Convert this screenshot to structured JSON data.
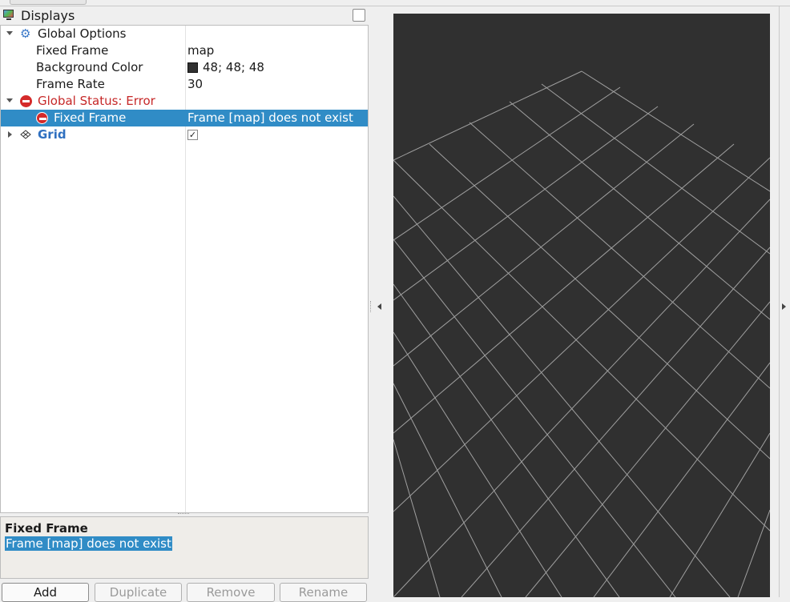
{
  "displays_panel": {
    "title": "Displays",
    "icon": "monitor-icon"
  },
  "tree": {
    "global_options": {
      "label": "Global Options",
      "fixed_frame": {
        "label": "Fixed Frame",
        "value": "map"
      },
      "background_color": {
        "label": "Background Color",
        "value": "48; 48; 48",
        "swatch": "#303030"
      },
      "frame_rate": {
        "label": "Frame Rate",
        "value": "30"
      }
    },
    "global_status": {
      "label": "Global Status: Error",
      "fixed_frame": {
        "label": "Fixed Frame",
        "value": "Frame [map] does not exist"
      }
    },
    "grid": {
      "label": "Grid",
      "enabled": true,
      "check_glyph": "✓"
    }
  },
  "description": {
    "title": "Fixed Frame",
    "text": "Frame [map] does not exist"
  },
  "buttons": {
    "add": "Add",
    "duplicate": "Duplicate",
    "remove": "Remove",
    "rename": "Rename"
  },
  "view": {
    "background_color": "#303030",
    "grid_color": "#a0a0a0"
  },
  "colors": {
    "selection": "#308cc6",
    "error": "#c62828",
    "link_blue": "#2f70c0"
  }
}
